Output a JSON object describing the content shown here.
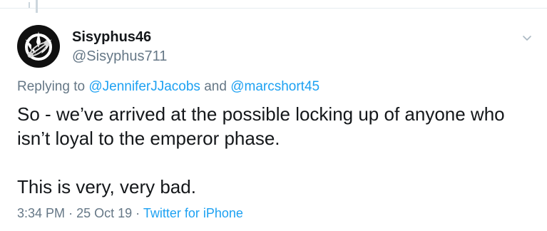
{
  "tweet": {
    "author": {
      "display_name": "Sisyphus46",
      "handle": "@Sisyphus711",
      "avatar_icon": "rebel-alliance-safety-pin-icon"
    },
    "replying": {
      "prefix": "Replying to",
      "mention_1": "@JenniferJJacobs",
      "joiner": "and",
      "mention_2": "@marcshort45"
    },
    "text": {
      "paragraph_1": "So - we’ve arrived at the possible locking up of anyone who isn’t loyal to the emperor phase.",
      "paragraph_2": "This is very, very bad."
    },
    "meta": {
      "time": "3:34 PM",
      "separator": "·",
      "date": "25 Oct 19",
      "source": "Twitter for iPhone"
    }
  },
  "colors": {
    "link": "#1da1f2",
    "secondary_text": "#657786",
    "primary_text": "#14171a",
    "divider": "#e6ecf0"
  },
  "icons": {
    "menu": "chevron-down-icon"
  }
}
